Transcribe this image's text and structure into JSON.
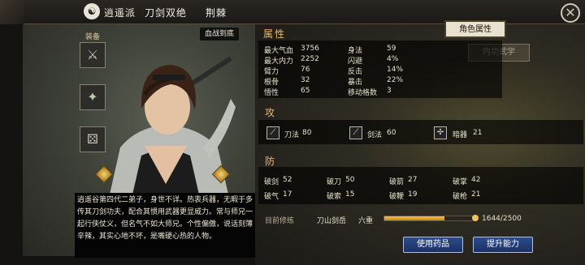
{
  "topbar": {
    "faction": "逍遥派",
    "title": "刀剑双绝",
    "subtitle": "荆棘"
  },
  "character": {
    "tag": "血战到底",
    "description": "逍遥谷第四代二弟子，身世不详。热衷兵器，无暇于多传其刀剑功夫，配合其惯用武器更显威力。常与师兄一起行侠仗义，但名气不如大师兄。个性偏傲，说话刻薄辛辣，其实心地不坏，是嘴硬心热的人物。"
  },
  "equipment": {
    "label": "装备",
    "slots": [
      "sword-icon",
      "armor-icon",
      "dice-icon"
    ]
  },
  "tabs": {
    "active": "角色属性",
    "inactive": "内功武学"
  },
  "attributes": {
    "section_title": "属性",
    "left": [
      {
        "label": "最大气血",
        "value": "3756"
      },
      {
        "label": "最大内力",
        "value": "2252"
      },
      {
        "label": "臂力",
        "value": "76"
      },
      {
        "label": "根骨",
        "value": "32"
      },
      {
        "label": "悟性",
        "value": "65"
      }
    ],
    "right": [
      {
        "label": "身法",
        "value": "59"
      },
      {
        "label": "闪避",
        "value": "4%"
      },
      {
        "label": "反击",
        "value": "14%"
      },
      {
        "label": "暴击",
        "value": "22%"
      },
      {
        "label": "移动格数",
        "value": "3"
      }
    ]
  },
  "attack": {
    "section_title": "攻",
    "items": [
      {
        "icon": "blade-icon",
        "label": "刀法",
        "value": "80"
      },
      {
        "icon": "sword-icon",
        "label": "剑法",
        "value": "60"
      },
      {
        "icon": "dart-icon",
        "label": "暗器",
        "value": "21"
      }
    ]
  },
  "defense": {
    "section_title": "防",
    "rows": [
      [
        {
          "label": "破剑",
          "value": "52"
        },
        {
          "label": "破刀",
          "value": "50"
        },
        {
          "label": "破箭",
          "value": "27"
        },
        {
          "label": "破掌",
          "value": "42"
        }
      ],
      [
        {
          "label": "破气",
          "value": "17"
        },
        {
          "label": "破索",
          "value": "15"
        },
        {
          "label": "破鞭",
          "value": "19"
        },
        {
          "label": "破枪",
          "value": "21"
        }
      ]
    ]
  },
  "cultivation": {
    "label": "目前修练",
    "skill": "刀山剑岳",
    "rank": "六重",
    "progress_text": "1644/2500",
    "progress_fraction": 0.6576
  },
  "buttons": {
    "use_medicine": "使用药品",
    "improve": "提升能力"
  },
  "colors": {
    "accent_gold": "#e6b879",
    "button_blue": "#1b3066"
  }
}
